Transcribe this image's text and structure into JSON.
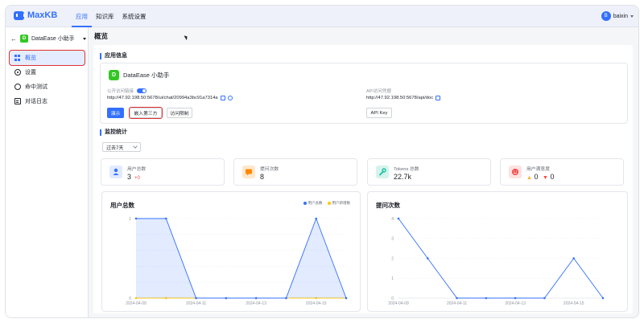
{
  "header": {
    "logo": "MaxKB",
    "nav": [
      "应用",
      "知识库",
      "系统设置"
    ],
    "user": "baixin"
  },
  "sidebar": {
    "app_name": "DataEase 小助手",
    "app_badge": "D",
    "items": [
      {
        "label": "概览",
        "icon": "grid-icon"
      },
      {
        "label": "设置",
        "icon": "gear-icon"
      },
      {
        "label": "命中测试",
        "icon": "target-icon"
      },
      {
        "label": "对话日志",
        "icon": "document-icon"
      }
    ]
  },
  "main": {
    "title": "概览",
    "app_info": {
      "section": "应用信息",
      "name": "DataEase 小助手",
      "public_label": "公开访问链接",
      "public_toggle": "on",
      "public_url": "http://47.92.198.50:5678/ui/chat/20994a3bc91a7314a",
      "api_label": "API访问凭据",
      "api_url": "http://47.92.198.50:5678/api/doc",
      "buttons": {
        "demo": "演示",
        "embed": "嵌入第三方",
        "access": "访问限制",
        "api_key": "API Key"
      }
    },
    "monitor": {
      "section": "监控统计",
      "period": "过去7天",
      "stats": [
        {
          "label": "用户总数",
          "value": "3",
          "delta": "+0",
          "color": "#3370ff",
          "icon": "user-icon"
        },
        {
          "label": "提问次数",
          "value": "8",
          "color": "#ff8800",
          "icon": "chat-icon"
        },
        {
          "label": "Tokens 总数",
          "value": "22.7k",
          "color": "#14c0a2",
          "icon": "wrench-icon"
        },
        {
          "label": "用户满意度",
          "like": "0",
          "dislike": "0",
          "color": "#f54a45",
          "icon": "smile-icon"
        }
      ]
    }
  },
  "chart_data": [
    {
      "type": "area",
      "title": "用户总数",
      "x": [
        "2024-04-09",
        "2024-04-10",
        "2024-04-11",
        "2024-04-12",
        "2024-04-13",
        "2024-04-14",
        "2024-04-15",
        "2024-04-16"
      ],
      "xticks": [
        "2024-04-09",
        "2024-04-11",
        "2024-04-13",
        "2024-04-15"
      ],
      "series": [
        {
          "name": "用户总数",
          "values": [
            1,
            1,
            0,
            0,
            0,
            0,
            1,
            0
          ],
          "color": "#3370ff"
        },
        {
          "name": "用户新增数",
          "values": [
            0,
            0,
            0,
            0,
            0,
            0,
            0,
            0
          ],
          "color": "#ffc60a"
        }
      ],
      "ylim": [
        0,
        1
      ],
      "yticks": [
        0,
        0.2,
        0.4,
        0.6,
        0.8,
        1
      ],
      "legend": "top-right"
    },
    {
      "type": "line",
      "title": "提问次数",
      "x": [
        "2024-04-09",
        "2024-04-10",
        "2024-04-11",
        "2024-04-12",
        "2024-04-13",
        "2024-04-14",
        "2024-04-15",
        "2024-04-16"
      ],
      "xticks": [
        "2024-04-09",
        "2024-04-11",
        "2024-04-13",
        "2024-04-15"
      ],
      "series": [
        {
          "values": [
            4,
            2,
            0,
            0,
            0,
            0,
            2,
            0
          ],
          "color": "#3370ff"
        }
      ],
      "ylim": [
        0,
        4
      ],
      "yticks": [
        0,
        1,
        2,
        3,
        4
      ]
    }
  ]
}
